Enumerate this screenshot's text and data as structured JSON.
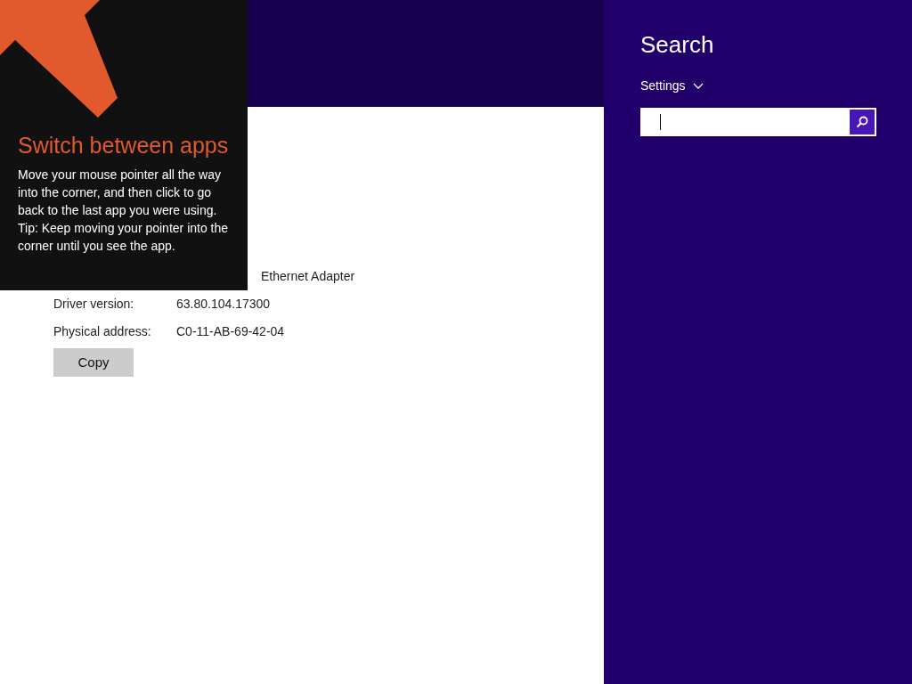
{
  "tip": {
    "title": "Switch between apps",
    "body": "Move your mouse pointer all the way into the corner, and then click to go back to the last app you were using.",
    "tip": "Tip: Keep moving your pointer into the corner until you see the app."
  },
  "adapter": {
    "partial_value": "Ethernet Adapter",
    "rows": [
      {
        "label": "Driver version:",
        "value": "63.80.104.17300"
      },
      {
        "label": "Physical address:",
        "value": "C0-11-AB-69-42-04"
      }
    ],
    "copy_button": "Copy"
  },
  "search_pane": {
    "title": "Search",
    "scope": "Settings"
  }
}
